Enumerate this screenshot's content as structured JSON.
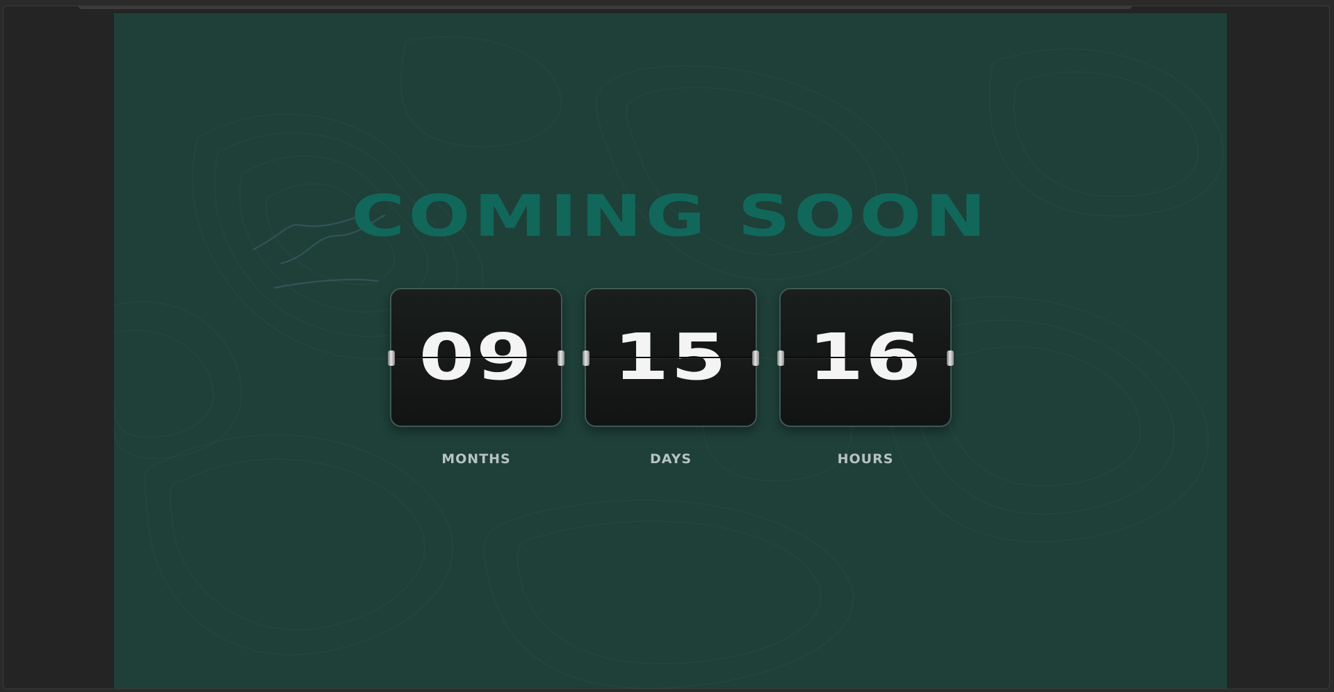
{
  "page": {
    "title": "COMING SOON"
  },
  "countdown": [
    {
      "value": "09",
      "label": "MONTHS"
    },
    {
      "value": "15",
      "label": "DAYS"
    },
    {
      "value": "16",
      "label": "HOURS"
    }
  ],
  "colors": {
    "background": "#1f3f39",
    "title": "#11685a",
    "card": "#161a19",
    "digits": "#f4f4f4",
    "label": "#b7c4c1",
    "frame": "#242424"
  }
}
